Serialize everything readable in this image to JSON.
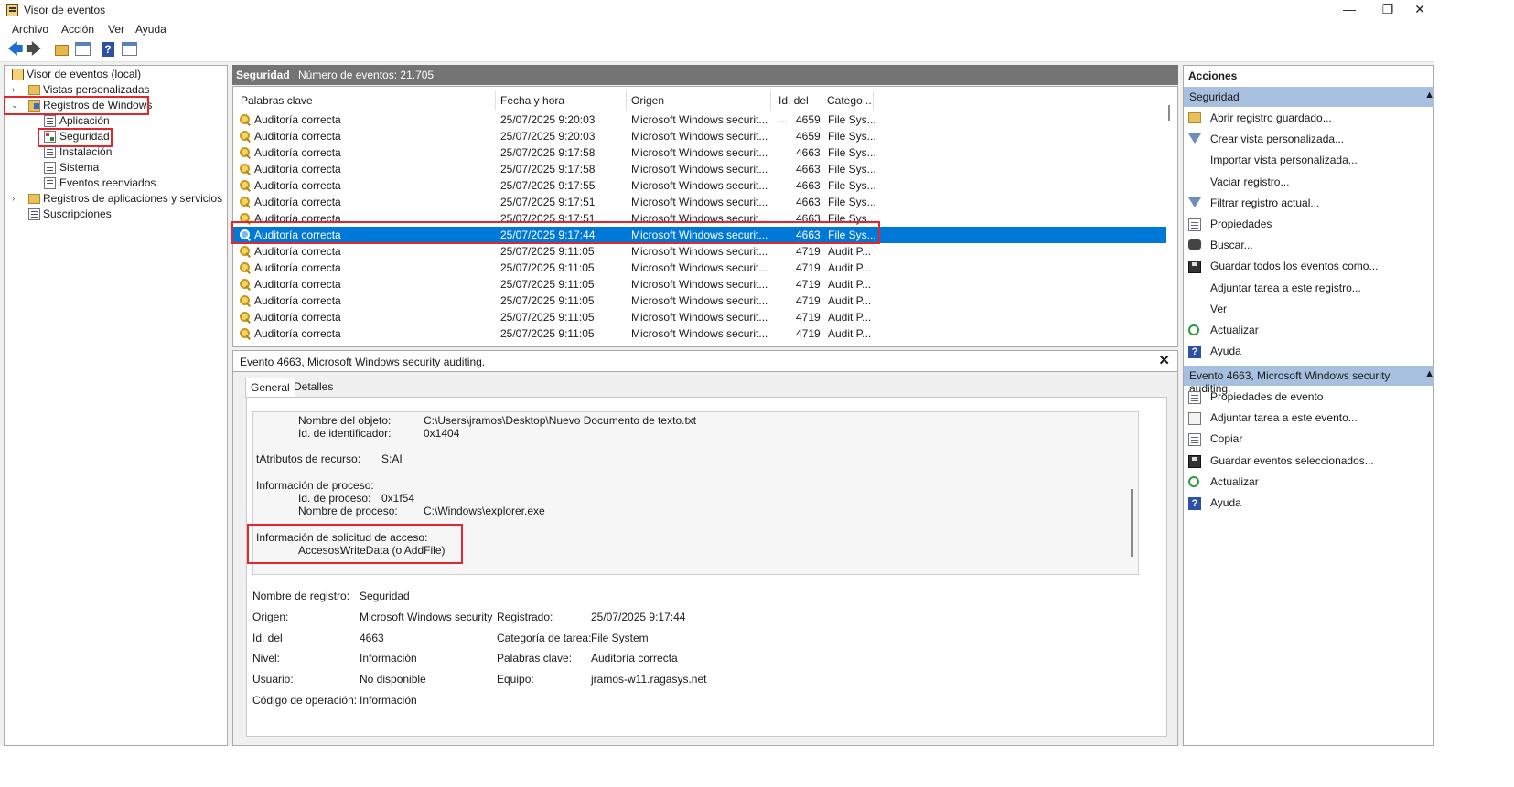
{
  "window": {
    "title": "Visor de eventos",
    "minimize": "—",
    "maximize": "❐",
    "close": "✕"
  },
  "menu": [
    "Archivo",
    "Acción",
    "Ver",
    "Ayuda"
  ],
  "toolbar": {
    "back": "🡄",
    "forward": "🡆",
    "help": "?"
  },
  "tree": {
    "root": "Visor de eventos (local)",
    "custom_views": "Vistas personalizadas",
    "windows_logs": "Registros de Windows",
    "logs": [
      "Aplicación",
      "Seguridad",
      "Instalación",
      "Sistema",
      "Eventos reenviados"
    ],
    "app_services": "Registros de aplicaciones y servicios",
    "subscriptions": "Suscripciones",
    "expander_closed": "›",
    "expander_open": "⌄"
  },
  "center": {
    "log_name": "Seguridad",
    "event_count": "Número de eventos: 21.705",
    "columns": [
      "Palabras clave",
      "Fecha y hora",
      "Origen",
      "Id. del ...",
      "Catego..."
    ],
    "rows": [
      [
        "Auditoría correcta",
        "25/07/2025 9:20:03",
        "Microsoft Windows securit...",
        "4659",
        "File Sys..."
      ],
      [
        "Auditoría correcta",
        "25/07/2025 9:20:03",
        "Microsoft Windows securit...",
        "4659",
        "File Sys..."
      ],
      [
        "Auditoría correcta",
        "25/07/2025 9:17:58",
        "Microsoft Windows securit...",
        "4663",
        "File Sys..."
      ],
      [
        "Auditoría correcta",
        "25/07/2025 9:17:58",
        "Microsoft Windows securit...",
        "4663",
        "File Sys..."
      ],
      [
        "Auditoría correcta",
        "25/07/2025 9:17:55",
        "Microsoft Windows securit...",
        "4663",
        "File Sys..."
      ],
      [
        "Auditoría correcta",
        "25/07/2025 9:17:51",
        "Microsoft Windows securit...",
        "4663",
        "File Sys..."
      ],
      [
        "Auditoría correcta",
        "25/07/2025 9:17:51",
        "Microsoft Windows securit...",
        "4663",
        "File Sys..."
      ],
      [
        "Auditoría correcta",
        "25/07/2025 9:17:44",
        "Microsoft Windows securit...",
        "4663",
        "File Sys..."
      ],
      [
        "Auditoría correcta",
        "25/07/2025 9:11:05",
        "Microsoft Windows securit...",
        "4719",
        "Audit P..."
      ],
      [
        "Auditoría correcta",
        "25/07/2025 9:11:05",
        "Microsoft Windows securit...",
        "4719",
        "Audit P..."
      ],
      [
        "Auditoría correcta",
        "25/07/2025 9:11:05",
        "Microsoft Windows securit...",
        "4719",
        "Audit P..."
      ],
      [
        "Auditoría correcta",
        "25/07/2025 9:11:05",
        "Microsoft Windows securit...",
        "4719",
        "Audit P..."
      ],
      [
        "Auditoría correcta",
        "25/07/2025 9:11:05",
        "Microsoft Windows securit...",
        "4719",
        "Audit P..."
      ],
      [
        "Auditoría correcta",
        "25/07/2025 9:11:05",
        "Microsoft Windows securit...",
        "4719",
        "Audit P..."
      ]
    ],
    "selected_row": 7
  },
  "detail": {
    "title": "Evento 4663, Microsoft Windows security auditing.",
    "close": "✕",
    "tabs": [
      "General",
      "Detalles"
    ],
    "description": {
      "object_name_label": "Nombre del objeto:",
      "object_name_value": "C:\\Users\\jramos\\Desktop\\Nuevo Documento de texto.txt",
      "handle_id_label": "Id. de identificador:",
      "handle_id_value": "0x1404",
      "resource_attr_label": "tAtributos de recurso:",
      "resource_attr_value": "S:AI",
      "process_info_label": "Información de proceso:",
      "process_id_label": "Id. de proceso:",
      "process_id_value": "0x1f54",
      "process_name_label": "Nombre de proceso:",
      "process_name_value": "C:\\Windows\\explorer.exe",
      "access_request_label": "Información de solicitud de acceso:",
      "accesses_label": "Accesos:",
      "accesses_value": "WriteData (o AddFile)"
    },
    "props": {
      "log_name_label": "Nombre de registro:",
      "log_name": "Seguridad",
      "source_label": "Origen:",
      "source": "Microsoft Windows security",
      "logged_label": "Registrado:",
      "logged": "25/07/2025 9:17:44",
      "event_id_label": "Id. del",
      "event_id": "4663",
      "task_label": "Categoría de tarea:",
      "task": "File System",
      "level_label": "Nivel:",
      "level": "Información",
      "keywords_label": "Palabras clave:",
      "keywords": "Auditoría correcta",
      "user_label": "Usuario:",
      "user": "No disponible",
      "computer_label": "Equipo:",
      "computer": "jramos-w11.ragasys.net",
      "opcode_label": "Código de operación:",
      "opcode": "Información"
    }
  },
  "actions": {
    "title": "Acciones",
    "section1": "Seguridad",
    "items1": [
      {
        "label": "Abrir registro guardado...",
        "icon": "open-folder-icon"
      },
      {
        "label": "Crear vista personalizada...",
        "icon": "filter-icon"
      },
      {
        "label": "Importar vista personalizada...",
        "icon": ""
      },
      {
        "label": "Vaciar registro...",
        "icon": ""
      },
      {
        "label": "Filtrar registro actual...",
        "icon": "filter-icon"
      },
      {
        "label": "Propiedades",
        "icon": "properties-icon"
      },
      {
        "label": "Buscar...",
        "icon": "binoculars-icon"
      },
      {
        "label": "Guardar todos los eventos como...",
        "icon": "save-icon"
      },
      {
        "label": "Adjuntar tarea a este registro...",
        "icon": ""
      },
      {
        "label": "Ver",
        "icon": ""
      },
      {
        "label": "Actualizar",
        "icon": "refresh-icon"
      },
      {
        "label": "Ayuda",
        "icon": "help-icon"
      }
    ],
    "section2": "Evento 4663, Microsoft Windows security auditing.",
    "items2": [
      {
        "label": "Propiedades de evento",
        "icon": "properties-icon"
      },
      {
        "label": "Adjuntar tarea a este evento...",
        "icon": "task-icon"
      },
      {
        "label": "Copiar",
        "icon": "copy-icon"
      },
      {
        "label": "Guardar eventos seleccionados...",
        "icon": "save-icon"
      },
      {
        "label": "Actualizar",
        "icon": "refresh-icon"
      },
      {
        "label": "Ayuda",
        "icon": "help-icon"
      }
    ],
    "section_arrow": "▲"
  },
  "colors": {
    "selection": "#0078d7",
    "highlight_box": "#e3262c",
    "section_bar": "#a8c0e0",
    "header_bar": "#747474"
  }
}
